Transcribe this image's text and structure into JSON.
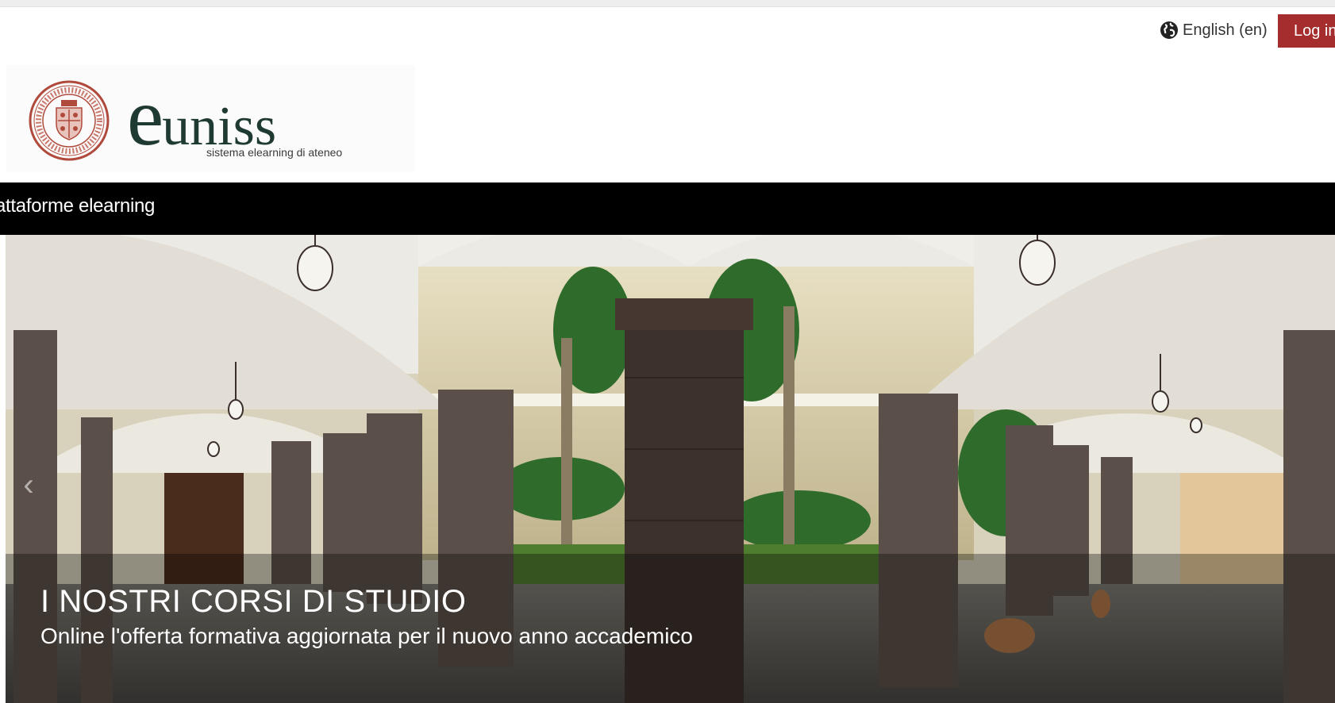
{
  "header": {
    "language_label": "English (en)",
    "login_label": "Log in"
  },
  "logo": {
    "brand_initial": "e",
    "brand_rest": "uniss",
    "tagline": "sistema elearning di ateneo"
  },
  "navbar": {
    "site_name": "attaforme elearning"
  },
  "hero": {
    "slide_title": "I NOSTRI CORSI DI STUDIO",
    "slide_subtitle": "Online l'offerta formativa aggiornata per il nuovo anno accademico"
  },
  "icons": {
    "language": "globe-icon",
    "seal": "university-seal-icon",
    "previous": "chevron-left-icon"
  },
  "colors": {
    "login_button": "#a62d2d",
    "brand": "#1f3a32",
    "seal": "#b04a3c",
    "navbar": "#000000"
  }
}
